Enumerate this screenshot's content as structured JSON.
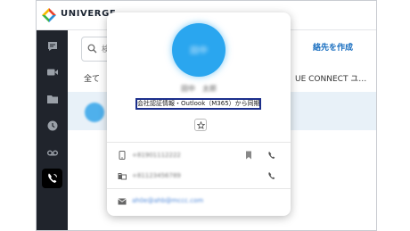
{
  "app": {
    "brand": "UNIVERGE"
  },
  "nav": [
    "chat-icon",
    "video-icon",
    "folder-icon",
    "clock-icon",
    "voicemail-icon",
    "phone-book-icon"
  ],
  "search": {
    "placeholder": "検"
  },
  "filter": {
    "all_label": "全て"
  },
  "right": {
    "create_label": "絡先を作成",
    "column_label": "UE CONNECT ユ…"
  },
  "contact": {
    "initials": "田中",
    "name": "田中　太郎",
    "sync_source": "会社認証情報・Outlook（M365）から同期",
    "phone_mobile": "+81901112222",
    "phone_office": "+81123456789",
    "email": "ah0e@ahb@mccc.com"
  },
  "colors": {
    "accent": "#2aa6ef",
    "rail": "#20242c",
    "highlight_border": "#1c2f8c",
    "link": "#1a6fc0"
  }
}
